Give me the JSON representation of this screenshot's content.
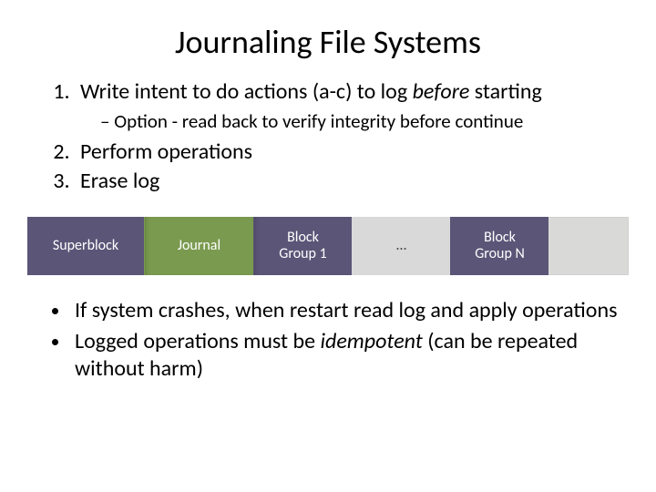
{
  "title": "Journaling File Systems",
  "list": {
    "item1_pre": "Write intent to do actions (a-c) to log ",
    "item1_em": "before",
    "item1_post": " starting",
    "item1_sub": "Option - read back to verify integrity before continue",
    "item2": "Perform operations",
    "item3": "Erase log"
  },
  "diagram": {
    "superblock": "Superblock",
    "journal": "Journal",
    "bg1a": "Block",
    "bg1b": "Group 1",
    "ellipsis": "…",
    "bgna": "Block",
    "bgnb": "Group N"
  },
  "bullets": {
    "b1": "If system crashes, when restart read log and apply operations",
    "b2_pre": "Logged operations must be ",
    "b2_em": "idempotent",
    "b2_post": " (can be repeated without harm)"
  }
}
